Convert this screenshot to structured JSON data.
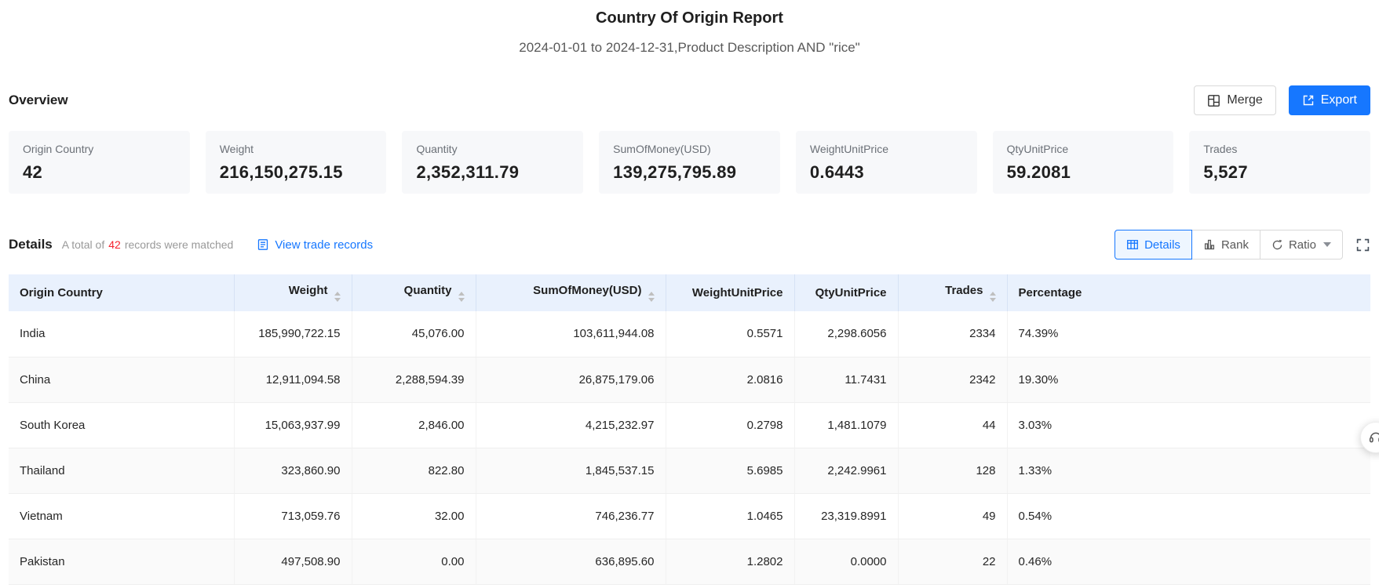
{
  "page": {
    "title": "Country Of Origin Report",
    "subtitle": "2024-01-01 to 2024-12-31,Product Description AND \"rice\""
  },
  "colors": {
    "accent": "#1677ff",
    "count_red": "#f5222d",
    "table_header_bg": "#e9f1fd",
    "card_bg": "#f7f8fa"
  },
  "overview": {
    "heading": "Overview",
    "merge_button": "Merge",
    "export_button": "Export",
    "cards": [
      {
        "label": "Origin Country",
        "value": "42"
      },
      {
        "label": "Weight",
        "value": "216,150,275.15"
      },
      {
        "label": "Quantity",
        "value": "2,352,311.79"
      },
      {
        "label": "SumOfMoney(USD)",
        "value": "139,275,795.89"
      },
      {
        "label": "WeightUnitPrice",
        "value": "0.6443"
      },
      {
        "label": "QtyUnitPrice",
        "value": "59.2081"
      },
      {
        "label": "Trades",
        "value": "5,527"
      }
    ]
  },
  "details": {
    "heading": "Details",
    "matched_prefix": "A total of",
    "matched_count": "42",
    "matched_suffix": "records were matched",
    "view_trade_records": "View trade records",
    "view_buttons": {
      "details": "Details",
      "rank": "Rank",
      "ratio": "Ratio"
    }
  },
  "table": {
    "columns": [
      {
        "label": "Origin Country",
        "align": "left",
        "sortable": false
      },
      {
        "label": "Weight",
        "align": "right",
        "sortable": true
      },
      {
        "label": "Quantity",
        "align": "right",
        "sortable": true
      },
      {
        "label": "SumOfMoney(USD)",
        "align": "right",
        "sortable": true
      },
      {
        "label": "WeightUnitPrice",
        "align": "right",
        "sortable": false
      },
      {
        "label": "QtyUnitPrice",
        "align": "right",
        "sortable": false
      },
      {
        "label": "Trades",
        "align": "right",
        "sortable": true
      },
      {
        "label": "Percentage",
        "align": "left",
        "sortable": false
      }
    ],
    "rows": [
      [
        "India",
        "185,990,722.15",
        "45,076.00",
        "103,611,944.08",
        "0.5571",
        "2,298.6056",
        "2334",
        "74.39%"
      ],
      [
        "China",
        "12,911,094.58",
        "2,288,594.39",
        "26,875,179.06",
        "2.0816",
        "11.7431",
        "2342",
        "19.30%"
      ],
      [
        "South Korea",
        "15,063,937.99",
        "2,846.00",
        "4,215,232.97",
        "0.2798",
        "1,481.1079",
        "44",
        "3.03%"
      ],
      [
        "Thailand",
        "323,860.90",
        "822.80",
        "1,845,537.15",
        "5.6985",
        "2,242.9961",
        "128",
        "1.33%"
      ],
      [
        "Vietnam",
        "713,059.76",
        "32.00",
        "746,236.77",
        "1.0465",
        "23,319.8991",
        "49",
        "0.54%"
      ],
      [
        "Pakistan",
        "497,508.90",
        "0.00",
        "636,895.60",
        "1.2802",
        "0.0000",
        "22",
        "0.46%"
      ]
    ]
  }
}
